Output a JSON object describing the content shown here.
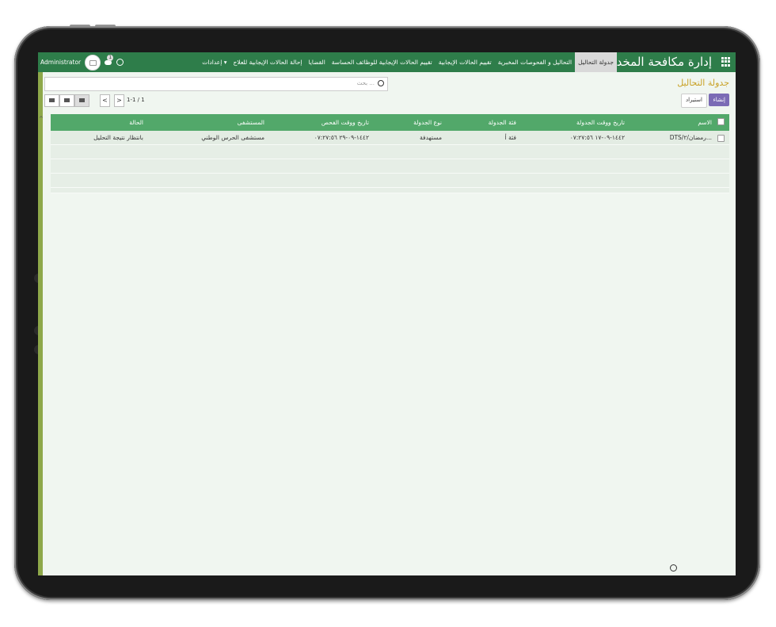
{
  "header": {
    "brand": "إدارة مكافحة المخدرات",
    "menu": [
      {
        "label": "جدولة التحاليل",
        "active": true
      },
      {
        "label": "التحاليل و الفحوصات المخبرية"
      },
      {
        "label": "تقييم الحالات الإيجابية"
      },
      {
        "label": "تقييم الحالات الإيجابية للوظائف الحساسة"
      },
      {
        "label": "القضايا"
      },
      {
        "label": "إحالة الحالات الإيجابية للعلاج"
      },
      {
        "label": "إعدادات ▾"
      }
    ],
    "user": "Administrator",
    "chat_badge": "1"
  },
  "page": {
    "title": "جدولة التحاليل",
    "create_label": "إنشاء",
    "import_label": "استيراد",
    "search_placeholder": "بحث ..."
  },
  "pager": {
    "prev": "<",
    "next": ">",
    "text": "1-1 / 1"
  },
  "table": {
    "columns": [
      "الاسم",
      "تاريخ ووقت الجدولة",
      "فئة الجدولة",
      "نوع الجدولة",
      "تاريخ ووقت الفحص",
      "المستشفى",
      "الحالة"
    ],
    "rows": [
      [
        "DTS/رمضان/٢...",
        "١٤٤٢-٠٩-١٧ ٠٧:٢٧:٥٦",
        "فئة أ",
        "مستهدفة",
        "١٤٤٢-٠٩-٢٩ ٠٧:٢٧:٥٦",
        "مستشفى الحرس الوطني",
        "بانتظار نتيجة التحليل"
      ]
    ]
  }
}
